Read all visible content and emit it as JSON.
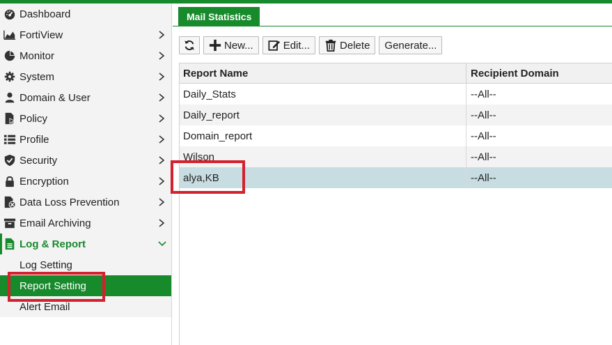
{
  "sidebar": {
    "items": [
      {
        "label": "Dashboard",
        "icon": "dashboard-icon",
        "chevron": false
      },
      {
        "label": "FortiView",
        "icon": "fortiview-icon",
        "chevron": true
      },
      {
        "label": "Monitor",
        "icon": "pie-chart-icon",
        "chevron": true
      },
      {
        "label": "System",
        "icon": "gear-icon",
        "chevron": true
      },
      {
        "label": "Domain & User",
        "icon": "user-icon",
        "chevron": true
      },
      {
        "label": "Policy",
        "icon": "policy-icon",
        "chevron": true
      },
      {
        "label": "Profile",
        "icon": "list-icon",
        "chevron": true
      },
      {
        "label": "Security",
        "icon": "shield-icon",
        "chevron": true
      },
      {
        "label": "Encryption",
        "icon": "lock-icon",
        "chevron": true
      },
      {
        "label": "Data Loss Prevention",
        "icon": "dlp-icon",
        "chevron": true
      },
      {
        "label": "Email Archiving",
        "icon": "archive-box-icon",
        "chevron": true
      },
      {
        "label": "Log & Report",
        "icon": "document-icon",
        "chevron": "down"
      }
    ],
    "subitems": [
      {
        "label": "Log Setting"
      },
      {
        "label": "Report Setting",
        "selected": true
      },
      {
        "label": "Alert Email"
      }
    ]
  },
  "tab": {
    "label": "Mail Statistics"
  },
  "toolbar": {
    "refresh_icon": "refresh-icon",
    "new_label": "New...",
    "edit_label": "Edit...",
    "delete_label": "Delete",
    "generate_label": "Generate..."
  },
  "table": {
    "columns": [
      "Report Name",
      "Recipient Domain"
    ],
    "rows": [
      [
        "Daily_Stats",
        "--All--"
      ],
      [
        "Daily_report",
        "--All--"
      ],
      [
        "Domain_report",
        "--All--"
      ],
      [
        "Wilson",
        "--All--"
      ],
      [
        "alya,KB",
        "--All--"
      ]
    ],
    "selected_row": 4
  },
  "colors": {
    "accent": "#178a2c",
    "highlight": "#d3212d",
    "selected_row": "#c8dde1"
  }
}
